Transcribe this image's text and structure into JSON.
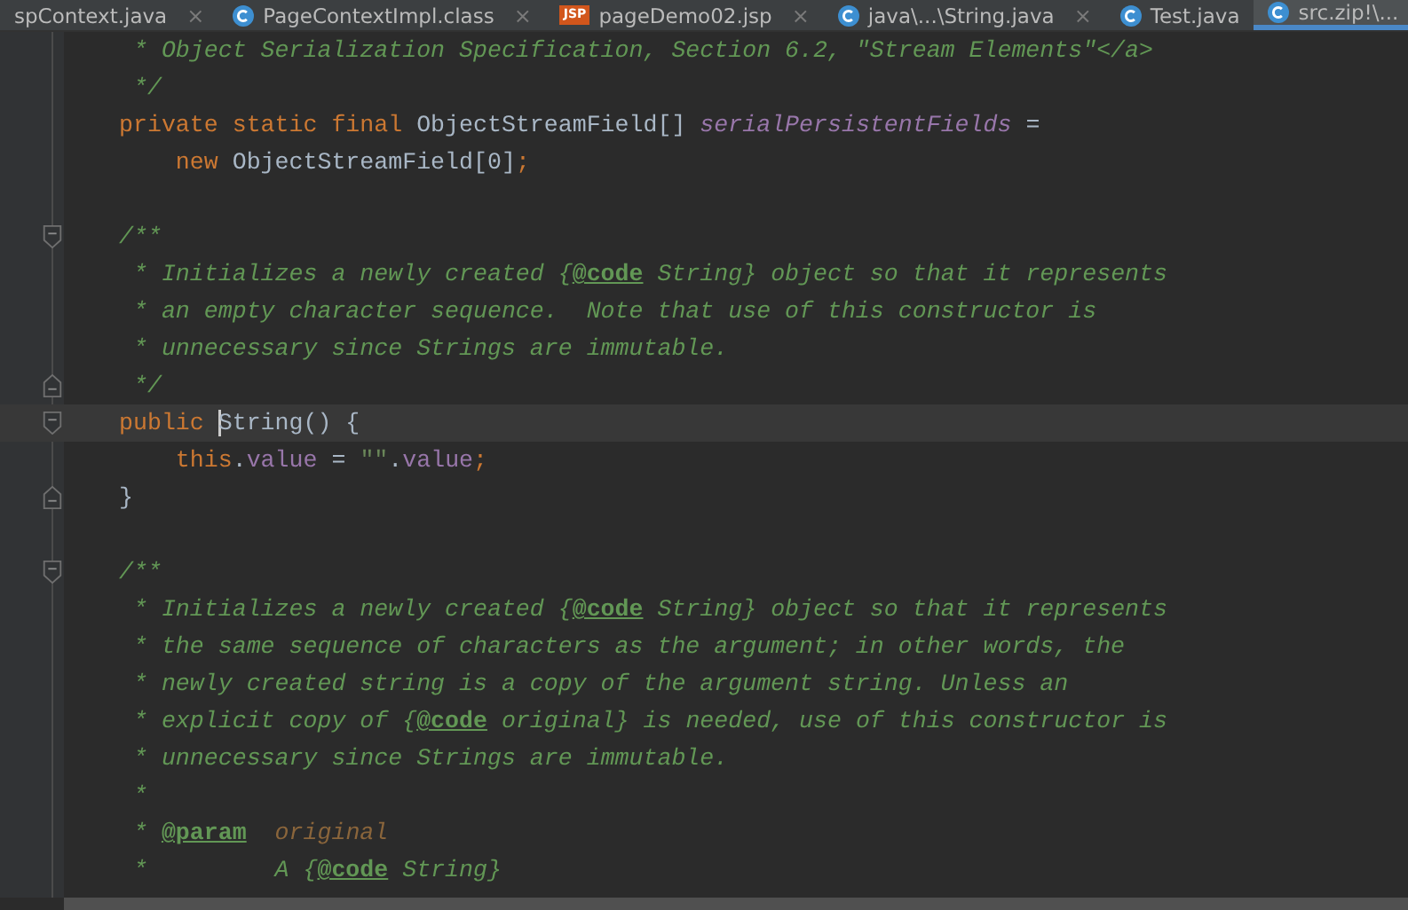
{
  "tabs": [
    {
      "label": "spContext.java",
      "kind": "plain",
      "closable": true,
      "selected": false
    },
    {
      "label": "PageContextImpl.class",
      "kind": "class",
      "closable": true,
      "selected": false
    },
    {
      "label": "pageDemo02.jsp",
      "kind": "jsp",
      "icon_text": "JSP",
      "closable": true,
      "selected": false
    },
    {
      "label": "java\\...\\String.java",
      "kind": "class",
      "closable": true,
      "selected": false
    },
    {
      "label": "Test.java",
      "kind": "class",
      "closable": false,
      "selected": false
    },
    {
      "label": "src.zip!\\...",
      "kind": "class",
      "closable": false,
      "selected": true
    }
  ],
  "close_glyph": "×",
  "editor": {
    "lines": [
      {
        "current": false,
        "fold_start": false,
        "fold_end": false,
        "tokens": [
          {
            "kind": "comment",
            "text": " * Object Serialization Specification, Section 6.2, \"Stream Elements\"</a>"
          }
        ]
      },
      {
        "current": false,
        "fold_start": false,
        "fold_end": false,
        "tokens": [
          {
            "kind": "comment",
            "text": " */"
          }
        ]
      },
      {
        "current": false,
        "fold_start": false,
        "fold_end": false,
        "tokens": [
          {
            "kind": "keyword",
            "text": "private static final "
          },
          {
            "kind": "plain",
            "text": "ObjectStreamField[] "
          },
          {
            "kind": "field",
            "text": "serialPersistentFields"
          },
          {
            "kind": "plain",
            "text": " ="
          }
        ]
      },
      {
        "current": false,
        "fold_start": false,
        "fold_end": false,
        "tokens": [
          {
            "kind": "keyword",
            "text": "    new "
          },
          {
            "kind": "plain",
            "text": "ObjectStreamField[0]"
          },
          {
            "kind": "keyword",
            "text": ";"
          }
        ]
      },
      {
        "current": false,
        "fold_start": false,
        "fold_end": false
      },
      {
        "current": false,
        "fold_start": true,
        "fold_end": false,
        "tokens": [
          {
            "kind": "comment",
            "text": "/**"
          }
        ]
      },
      {
        "current": false,
        "fold_start": false,
        "fold_end": false,
        "tokens": [
          {
            "kind": "comment",
            "text": " * Initializes a newly created {"
          },
          {
            "kind": "tag",
            "text": "@code"
          },
          {
            "kind": "comment",
            "text": " String} object so that it represents"
          }
        ]
      },
      {
        "current": false,
        "fold_start": false,
        "fold_end": false,
        "tokens": [
          {
            "kind": "comment",
            "text": " * an empty character sequence.  Note that use of this constructor is"
          }
        ]
      },
      {
        "current": false,
        "fold_start": false,
        "fold_end": false,
        "tokens": [
          {
            "kind": "comment",
            "text": " * unnecessary since Strings are immutable."
          }
        ]
      },
      {
        "current": false,
        "fold_start": false,
        "fold_end": true,
        "tokens": [
          {
            "kind": "comment",
            "text": " */"
          }
        ]
      },
      {
        "current": true,
        "fold_start": true,
        "fold_end": false,
        "tokens": [
          {
            "kind": "keyword",
            "text": "public "
          },
          {
            "kind": "plain",
            "text": "String() {",
            "caret": true
          }
        ]
      },
      {
        "current": false,
        "fold_start": false,
        "fold_end": false,
        "tokens": [
          {
            "kind": "keyword",
            "text": "    this"
          },
          {
            "kind": "plain",
            "text": "."
          },
          {
            "kind": "member",
            "text": "value"
          },
          {
            "kind": "plain",
            "text": " = "
          },
          {
            "kind": "string",
            "text": "\"\""
          },
          {
            "kind": "plain",
            "text": "."
          },
          {
            "kind": "member",
            "text": "value"
          },
          {
            "kind": "keyword",
            "text": ";"
          }
        ]
      },
      {
        "current": false,
        "fold_start": false,
        "fold_end": true,
        "tokens": [
          {
            "kind": "plain",
            "text": "}"
          }
        ]
      },
      {
        "current": false,
        "fold_start": false,
        "fold_end": false
      },
      {
        "current": false,
        "fold_start": true,
        "fold_end": false,
        "tokens": [
          {
            "kind": "comment",
            "text": "/**"
          }
        ]
      },
      {
        "current": false,
        "fold_start": false,
        "fold_end": false,
        "tokens": [
          {
            "kind": "comment",
            "text": " * Initializes a newly created {"
          },
          {
            "kind": "tag",
            "text": "@code"
          },
          {
            "kind": "comment",
            "text": " String} object so that it represents"
          }
        ]
      },
      {
        "current": false,
        "fold_start": false,
        "fold_end": false,
        "tokens": [
          {
            "kind": "comment",
            "text": " * the same sequence of characters as the argument; in other words, the"
          }
        ]
      },
      {
        "current": false,
        "fold_start": false,
        "fold_end": false,
        "tokens": [
          {
            "kind": "comment",
            "text": " * newly created string is a copy of the argument string. Unless an"
          }
        ]
      },
      {
        "current": false,
        "fold_start": false,
        "fold_end": false,
        "tokens": [
          {
            "kind": "comment",
            "text": " * explicit copy of {"
          },
          {
            "kind": "tag",
            "text": "@code"
          },
          {
            "kind": "comment",
            "text": " original} is needed, use of this constructor is"
          }
        ]
      },
      {
        "current": false,
        "fold_start": false,
        "fold_end": false,
        "tokens": [
          {
            "kind": "comment",
            "text": " * unnecessary since Strings are immutable."
          }
        ]
      },
      {
        "current": false,
        "fold_start": false,
        "fold_end": false,
        "tokens": [
          {
            "kind": "comment",
            "text": " *"
          }
        ]
      },
      {
        "current": false,
        "fold_start": false,
        "fold_end": false,
        "tokens": [
          {
            "kind": "comment",
            "text": " * "
          },
          {
            "kind": "tag",
            "text": "@param"
          },
          {
            "kind": "param",
            "text": "  original"
          }
        ]
      },
      {
        "current": false,
        "fold_start": false,
        "fold_end": false,
        "tokens": [
          {
            "kind": "comment",
            "text": " *         A {"
          },
          {
            "kind": "tag",
            "text": "@code"
          },
          {
            "kind": "comment",
            "text": " String}"
          }
        ]
      }
    ]
  }
}
